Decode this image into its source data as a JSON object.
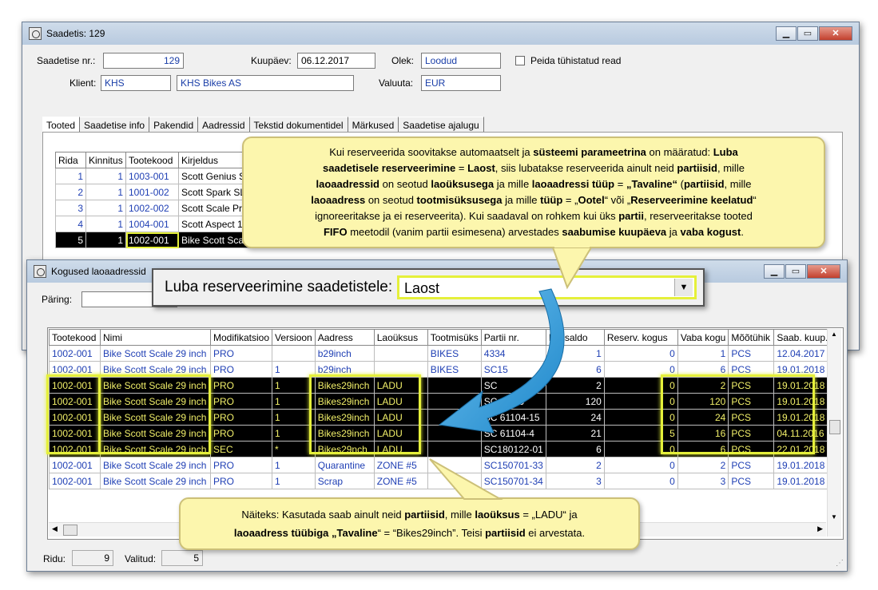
{
  "win1": {
    "title": "Saadetis: 129",
    "fields": {
      "nr_label": "Saadetise nr.:",
      "nr_value": "129",
      "date_label": "Kuupäev:",
      "date_value": "06.12.2017",
      "status_label": "Olek:",
      "status_value": "Loodud",
      "hide_label": "Peida tühistatud read",
      "client_label": "Klient:",
      "client_code": "KHS",
      "client_name": "KHS Bikes AS",
      "currency_label": "Valuuta:",
      "currency_value": "EUR"
    },
    "tabs": [
      "Tooted",
      "Saadetise info",
      "Pakendid",
      "Aadressid",
      "Tekstid dokumentidel",
      "Märkused",
      "Saadetise ajalugu"
    ],
    "grid": {
      "headers": [
        "Rida",
        "Kinnitus",
        "Tootekood",
        "Kirjeldus"
      ],
      "rows": [
        [
          "1",
          "1",
          "1003-001",
          "Scott Genius S"
        ],
        [
          "2",
          "1",
          "1001-002",
          "Scott Spark SL"
        ],
        [
          "3",
          "1",
          "1002-002",
          "Scott Scale Pr"
        ],
        [
          "4",
          "1",
          "1004-001",
          "Scott Aspect 1"
        ],
        [
          "5",
          "1",
          "1002-001",
          "Bike Scott Sca"
        ]
      ]
    }
  },
  "win2": {
    "title": "Kogused laoaadressid",
    "search_label": "Päring:",
    "grid": {
      "headers": [
        "Tootekood",
        "Nimi",
        "Modifikatsioo",
        "Versioon",
        "Aadress",
        "Laoüksus",
        "Tootmisüks",
        "Partii nr.",
        "Laosaldo",
        "Reserv. kogus",
        "Vaba kogu",
        "Mõõtühik",
        "Saab. kuup."
      ],
      "rows": [
        [
          "1002-001",
          "Bike Scott Scale 29 inch",
          "PRO",
          "",
          "b29inch",
          "",
          "BIKES",
          "4334",
          "1",
          "0",
          "1",
          "PCS",
          "12.04.2017"
        ],
        [
          "1002-001",
          "Bike Scott Scale 29 inch",
          "PRO",
          "1",
          "b29inch",
          "",
          "BIKES",
          "SC15",
          "6",
          "0",
          "6",
          "PCS",
          "19.01.2018"
        ],
        [
          "1002-001",
          "Bike Scott Scale 29 inch",
          "PRO",
          "1",
          "Bikes29inch",
          "LADU",
          "",
          "SC",
          "2",
          "0",
          "2",
          "PCS",
          "19.01.2018"
        ],
        [
          "1002-001",
          "Bike Scott Scale 29 inch",
          "PRO",
          "1",
          "Bikes29inch",
          "LADU",
          "",
          "SC 01-49",
          "120",
          "0",
          "120",
          "PCS",
          "19.01.2018"
        ],
        [
          "1002-001",
          "Bike Scott Scale 29 inch",
          "PRO",
          "1",
          "Bikes29inch",
          "LADU",
          "",
          "SC 61104-15",
          "24",
          "0",
          "24",
          "PCS",
          "19.01.2018"
        ],
        [
          "1002-001",
          "Bike Scott Scale 29 inch",
          "PRO",
          "1",
          "Bikes29inch",
          "LADU",
          "",
          "SC 61104-4",
          "21",
          "5",
          "16",
          "PCS",
          "04.11.2016"
        ],
        [
          "1002-001",
          "Bike Scott Scale 29 inch",
          "SEC",
          "*",
          "Bikes29nch",
          "LADU",
          "",
          "SC180122-01",
          "6",
          "0",
          "6",
          "PCS",
          "22.01.2018"
        ],
        [
          "1002-001",
          "Bike Scott Scale 29 inch",
          "PRO",
          "1",
          "Quarantine",
          "ZONE #5",
          "",
          "SC150701-33",
          "2",
          "0",
          "2",
          "PCS",
          "19.01.2018"
        ],
        [
          "1002-001",
          "Bike Scott Scale 29 inch",
          "PRO",
          "1",
          "Scrap",
          "ZONE #5",
          "",
          "SC150701-34",
          "3",
          "0",
          "3",
          "PCS",
          "19.01.2018"
        ]
      ]
    },
    "status": {
      "rows_label": "Ridu:",
      "rows_value": "9",
      "sel_label": "Valitud:",
      "sel_value": "5"
    }
  },
  "dropdown": {
    "label": "Luba reserveerimine saadetistele:",
    "value": "Laost"
  },
  "callout_top": {
    "lines": [
      [
        [
          "Kui reserveerida soovitakse automaatselt ja ",
          0
        ],
        [
          "süsteemi parameetrina",
          1
        ],
        [
          " on määratud: ",
          0
        ],
        [
          "Luba",
          1
        ]
      ],
      [
        [
          "saadetisele reserveerimine",
          1
        ],
        [
          " = ",
          0
        ],
        [
          "Laost",
          1
        ],
        [
          ", siis lubatakse reserveerida ainult neid ",
          0
        ],
        [
          "partiisid",
          1
        ],
        [
          ", mille",
          0
        ]
      ],
      [
        [
          "laoaadressid",
          1
        ],
        [
          " on seotud ",
          0
        ],
        [
          "laoüksusega",
          1
        ],
        [
          " ja mille ",
          0
        ],
        [
          "laoaadressi tüüp",
          1
        ],
        [
          " = ",
          0
        ],
        [
          "„Tavaline“",
          1
        ],
        [
          " (",
          0
        ],
        [
          "partiisid",
          1
        ],
        [
          ", mille",
          0
        ]
      ],
      [
        [
          "laoaadress",
          1
        ],
        [
          " on seotud ",
          0
        ],
        [
          "tootmisüksusega",
          1
        ],
        [
          " ja mille ",
          0
        ],
        [
          "tüüp",
          1
        ],
        [
          " = „",
          0
        ],
        [
          "Ootel",
          1
        ],
        [
          "“ või „",
          0
        ],
        [
          "Reserveerimine keelatud",
          1
        ],
        [
          "“",
          0
        ]
      ],
      [
        [
          "ignoreeritakse ja ei reserveerita). Kui saadaval on rohkem kui üks ",
          0
        ],
        [
          "partii",
          1
        ],
        [
          ", reserveeritakse tooted",
          0
        ]
      ],
      [
        [
          "FIFO",
          1
        ],
        [
          " meetodil (vanim partii esimesena) arvestades ",
          0
        ],
        [
          "saabumise kuupäeva",
          1
        ],
        [
          " ja ",
          0
        ],
        [
          "vaba kogust",
          1
        ],
        [
          ".",
          0
        ]
      ]
    ]
  },
  "callout_bottom": {
    "lines": [
      [
        [
          "Näiteks: Kasutada saab ainult neid ",
          0
        ],
        [
          "partiisid",
          1
        ],
        [
          ", mille ",
          0
        ],
        [
          "laoüksus",
          1
        ],
        [
          " = „LADU“ ja",
          0
        ]
      ],
      [
        [
          "laoaadress tüübiga „Tavaline",
          1
        ],
        [
          "“ = “Bikes29inch”. Teisi ",
          0
        ],
        [
          "partiisid",
          1
        ],
        [
          " ei arvestata.",
          0
        ]
      ]
    ]
  }
}
